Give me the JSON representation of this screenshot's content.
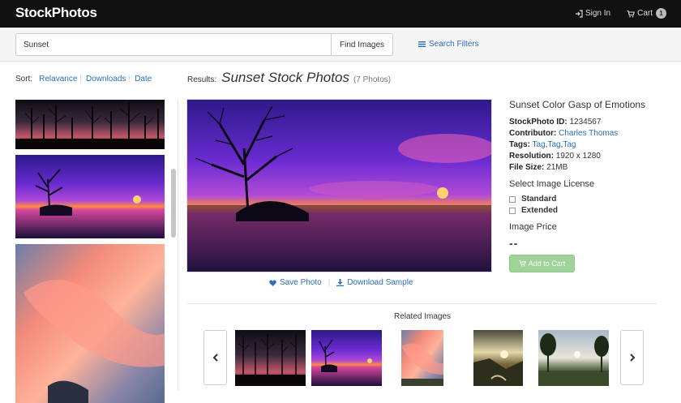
{
  "brand": "StockPhotos",
  "nav": {
    "sign_in": "Sign In",
    "cart": "Cart",
    "cart_count": "1"
  },
  "search": {
    "value": "Sunset",
    "button": "Find Images",
    "filters": "Search Filters"
  },
  "sort": {
    "label": "Sort:",
    "options": [
      "Relavance",
      "Downloads",
      "Date"
    ]
  },
  "results": {
    "label": "Results:",
    "query": "Sunset Stock Photos",
    "count": "(7 Photos)"
  },
  "photo": {
    "title": "Sunset Color Gasp of Emotions",
    "id_label": "StockPhoto ID:",
    "id": "1234567",
    "contributor_label": "Contributor:",
    "contributor": "Charles Thomas",
    "tags_label": "Tags:",
    "tags": [
      "Tag",
      "Tag",
      "Tag"
    ],
    "resolution_label": "Resolution:",
    "resolution": "1920 x 1280",
    "size_label": "File Size:",
    "size": "21MB",
    "license_heading": "Select Image License",
    "licenses": [
      "Standard",
      "Extended"
    ],
    "price_heading": "Image Price",
    "price": "--",
    "add_to_cart": "Add to Cart",
    "save": "Save Photo",
    "download": "Download Sample"
  },
  "related": {
    "title": "Related Images"
  },
  "colors": {
    "accent": "#2a6ebb",
    "topbar": "#111111",
    "cart_button": "#9fd39a"
  }
}
